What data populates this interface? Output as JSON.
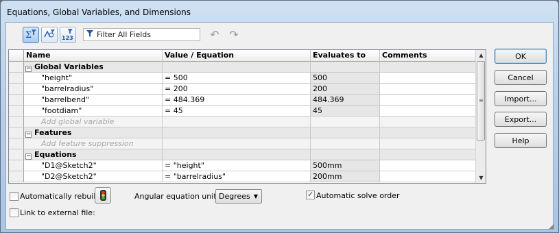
{
  "window": {
    "title": "Equations, Global Variables, and Dimensions"
  },
  "toolbar": {
    "buttons": [
      {
        "name": "equation-view",
        "icon": "sigma-filter-icon",
        "active": true
      },
      {
        "name": "sketch-equation-view",
        "icon": "sketch-equation-icon",
        "active": false
      },
      {
        "name": "dimension-view",
        "icon": "dimension-123-icon",
        "active": false
      }
    ],
    "filter_placeholder": "Filter All Fields",
    "undo_icon": "undo-icon",
    "redo_icon": "redo-icon"
  },
  "grid": {
    "columns": [
      "Name",
      "Value / Equation",
      "Evaluates to",
      "Comments"
    ],
    "sections": [
      {
        "title": "Global Variables",
        "rows": [
          {
            "name": "\"height\"",
            "value": "= 500",
            "evaluates": "500",
            "comment": ""
          },
          {
            "name": "\"barrelradius\"",
            "value": "= 200",
            "evaluates": "200",
            "comment": ""
          },
          {
            "name": "\"barrelbend\"",
            "value": "= 484.369",
            "evaluates": "484.369",
            "comment": ""
          },
          {
            "name": "\"footdiam\"",
            "value": "= 45",
            "evaluates": "45",
            "comment": ""
          }
        ],
        "placeholder": "Add global variable"
      },
      {
        "title": "Features",
        "rows": [],
        "placeholder": "Add feature suppression"
      },
      {
        "title": "Equations",
        "rows": [
          {
            "name": "\"D1@Sketch2\"",
            "value": "= \"height\"",
            "evaluates": "500mm",
            "comment": ""
          },
          {
            "name": "\"D2@Sketch2\"",
            "value": "= \"barrelradius\"",
            "evaluates": "200mm",
            "comment": ""
          }
        ]
      }
    ]
  },
  "buttons": {
    "ok": "OK",
    "cancel": "Cancel",
    "import": "Import...",
    "export": "Export...",
    "help": "Help"
  },
  "bottom": {
    "auto_rebuild_label": "Automatically rebuild",
    "auto_rebuild_checked": false,
    "angular_units_label": "Angular equation units:",
    "angular_units_value": "Degrees",
    "auto_solve_label": "Automatic solve order",
    "auto_solve_checked": true,
    "link_external_label": "Link to external file:",
    "link_external_checked": false
  },
  "colors": {
    "accent": "#3c7fb1",
    "title_bar": "#b9d1ea",
    "evaluates_bg": "#e6e6e6"
  }
}
